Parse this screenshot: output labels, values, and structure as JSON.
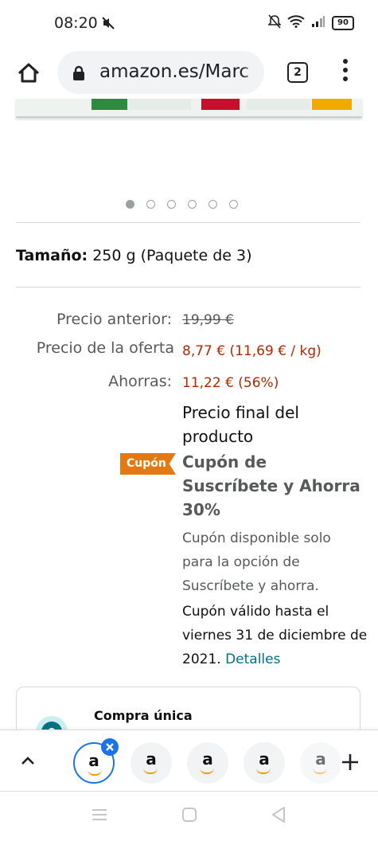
{
  "status_bar": {
    "time": "08:20",
    "battery": "90"
  },
  "browser": {
    "url": "amazon.es/Marc",
    "tab_count": "2"
  },
  "product": {
    "size_label": "Tamaño:",
    "size_value": "250 g (Paquete de 3)",
    "image_dots": 6,
    "active_dot": 0
  },
  "pricing": {
    "previous_label": "Precio anterior:",
    "previous_value": "19,99 €",
    "offer_label": "Precio de la oferta",
    "offer_value": "8,77 € (11,69 € / kg)",
    "savings_label": "Ahorras:",
    "savings_value": "11,22 € (56%)",
    "final_price_text": "Precio final del producto"
  },
  "coupon": {
    "badge": "Cupón",
    "title": "Cupón de Suscríbete y Ahorra 30%",
    "note": "Cupón disponible solo para la opción de Suscríbete y ahorra.",
    "validity": "Cupón válido hasta el viernes 31 de diciembre de 2021.",
    "details_link": "Detalles"
  },
  "purchase_option": {
    "title": "Compra única"
  },
  "tab_strip": {
    "tab_icon_letter": "a",
    "tabs": 5
  },
  "colors": {
    "price_red": "#b12704",
    "coupon_orange": "#e47911",
    "link_teal": "#007185",
    "chrome_blue": "#1a73e8"
  }
}
